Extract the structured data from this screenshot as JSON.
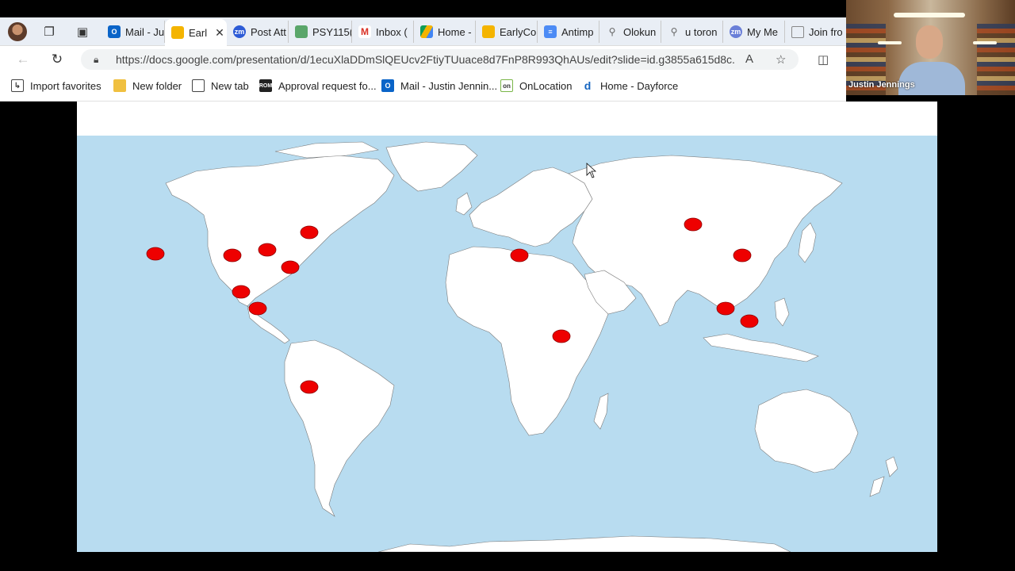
{
  "browser": {
    "tabs": [
      {
        "label": "",
        "icon": "workspaces-icon"
      },
      {
        "label": "",
        "icon": "tab-actions-icon"
      },
      {
        "label": "Mail - Ju",
        "icon": "outlook-icon",
        "color": "#0a64c8"
      },
      {
        "label": "Earl",
        "icon": "slides-icon",
        "color": "#f4b400",
        "active": true
      },
      {
        "label": "Post Att",
        "icon": "zoom-icon",
        "color": "#2d5bd6"
      },
      {
        "label": "PSY115(",
        "icon": "sheet-icon",
        "color": "#5aa66a"
      },
      {
        "label": "Inbox (",
        "icon": "gmail-icon",
        "color": "#d93025"
      },
      {
        "label": "Home -",
        "icon": "drive-icon",
        "color": "#1a73e8"
      },
      {
        "label": "EarlyCo",
        "icon": "slides-icon",
        "color": "#f4b400"
      },
      {
        "label": "Antimp",
        "icon": "docs-icon",
        "color": "#4c8bf5"
      },
      {
        "label": "Olokun",
        "icon": "search-icon",
        "color": "#888888"
      },
      {
        "label": "u toron",
        "icon": "search-icon",
        "color": "#888888"
      },
      {
        "label": "My Me",
        "icon": "zoom-icon",
        "color": "#6a7fd8"
      },
      {
        "label": "Join fro",
        "icon": "page-icon",
        "color": "#888888"
      }
    ],
    "url": "https://docs.google.com/presentation/d/1ecuXlaDDmSlQEUcv2FtiyTUuace8d7FnP8R993QhAUs/edit?slide=id.g3855a615d8c...",
    "bookmarks": [
      {
        "label": "Import favorites",
        "icon": "import-icon"
      },
      {
        "label": "New folder",
        "icon": "folder-icon",
        "color": "#f0c040"
      },
      {
        "label": "New tab",
        "icon": "newtab-icon"
      },
      {
        "label": "Approval request fo...",
        "icon": "rom-icon",
        "color": "#222222"
      },
      {
        "label": "Mail - Justin Jennin...",
        "icon": "outlook-icon",
        "color": "#0a64c8"
      },
      {
        "label": "OnLocation",
        "icon": "onlocation-icon",
        "color": "#7ab648"
      },
      {
        "label": "Home - Dayforce",
        "icon": "dayforce-icon",
        "color": "#1565c0"
      }
    ]
  },
  "video": {
    "name": "Justin Jennings"
  },
  "map": {
    "ocean_color": "#b8dcf0",
    "land_color": "#ffffff",
    "marker_color": "#ee0000",
    "markers": [
      {
        "name": "pacific-marker",
        "region": "Hawaii"
      },
      {
        "name": "north-america-west-marker",
        "region": "Southwest USA"
      },
      {
        "name": "north-america-central-marker",
        "region": "Central USA"
      },
      {
        "name": "north-america-northeast-marker",
        "region": "Great Lakes"
      },
      {
        "name": "north-america-southeast-marker",
        "region": "Southeast USA"
      },
      {
        "name": "mexico-marker",
        "region": "Northern Mexico"
      },
      {
        "name": "mesoamerica-marker",
        "region": "Mesoamerica"
      },
      {
        "name": "andes-marker",
        "region": "Peru"
      },
      {
        "name": "mediterranean-marker",
        "region": "Mediterranean"
      },
      {
        "name": "east-africa-marker",
        "region": "East Africa"
      },
      {
        "name": "central-asia-marker",
        "region": "Mongolia"
      },
      {
        "name": "china-marker",
        "region": "China"
      },
      {
        "name": "southeast-asia-west-marker",
        "region": "Myanmar"
      },
      {
        "name": "southeast-asia-east-marker",
        "region": "Cambodia"
      }
    ]
  }
}
